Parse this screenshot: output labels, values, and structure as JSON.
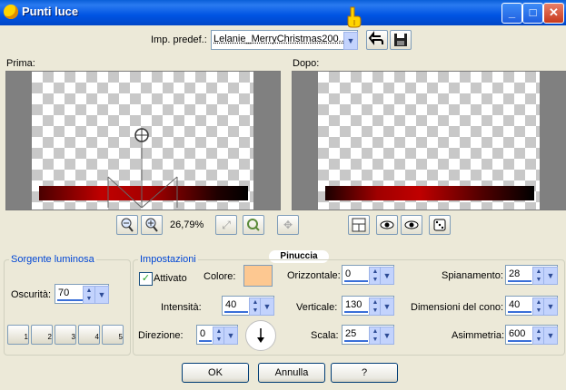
{
  "window": {
    "title": "Punti luce",
    "minimize": "_",
    "maximize": "□",
    "close": "✕"
  },
  "preset": {
    "label": "Imp. predef.:",
    "value": "Lelanie_MerryChristmas200..."
  },
  "preview": {
    "before_label": "Prima:",
    "after_label": "Dopo:",
    "zoom": "26,79%",
    "actual_size_glyph": "⤢"
  },
  "watermark": "Pinuccia",
  "light_source": {
    "title": "Sorgente luminosa",
    "darkness_label": "Oscurità:",
    "darkness_value": "70",
    "presets": [
      "1",
      "2",
      "3",
      "4",
      "5"
    ]
  },
  "settings": {
    "title": "Impostazioni",
    "enabled_label": "Attivato",
    "color_label": "Colore:",
    "color_value": "#fdc891",
    "horizontal_label": "Orizzontale:",
    "horizontal_value": "0",
    "flattening_label": "Spianamento:",
    "flattening_value": "28",
    "intensity_label": "Intensità:",
    "intensity_value": "40",
    "vertical_label": "Verticale:",
    "vertical_value": "130",
    "cone_label": "Dimensioni del cono:",
    "cone_value": "40",
    "direction_label": "Direzione:",
    "direction_value": "0",
    "scale_label": "Scala:",
    "scale_value": "25",
    "asymmetry_label": "Asimmetria:",
    "asymmetry_value": "600"
  },
  "buttons": {
    "ok": "OK",
    "cancel": "Annulla",
    "help": "?"
  },
  "colors": {
    "accent": "#0054e3",
    "group_title": "#0046d5"
  }
}
